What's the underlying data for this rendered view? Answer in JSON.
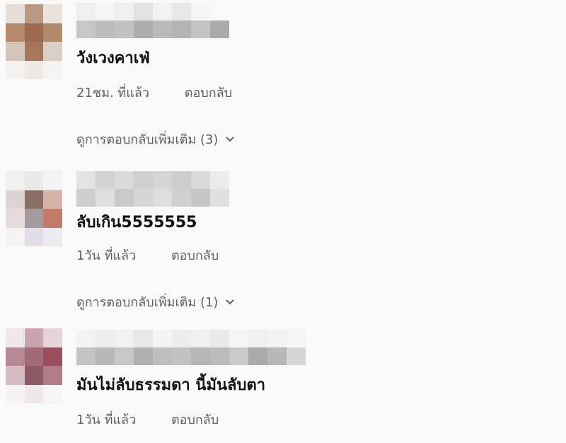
{
  "comments": [
    {
      "text": "วังเวงคาเฟ่",
      "time": "21ชม. ที่แล้ว",
      "reply_label": "ตอบกลับ",
      "more_replies": "ดูการตอบกลับเพิ่มเติม (3)"
    },
    {
      "text": "ลับเกิน5555555",
      "time": "1วัน ที่แล้ว",
      "reply_label": "ตอบกลับ",
      "more_replies": "ดูการตอบกลับเพิ่มเติม (1)"
    },
    {
      "text": "มันไม่ลับธรรมดา นี้มันลับตา",
      "time": "1วัน ที่แล้ว",
      "reply_label": "ตอบกลับ"
    }
  ],
  "icons": {
    "expand": "chevron-down-icon"
  },
  "colors": {
    "background": "#f9f9f9",
    "secondary_text": "#606060",
    "primary_text": "#111111"
  }
}
